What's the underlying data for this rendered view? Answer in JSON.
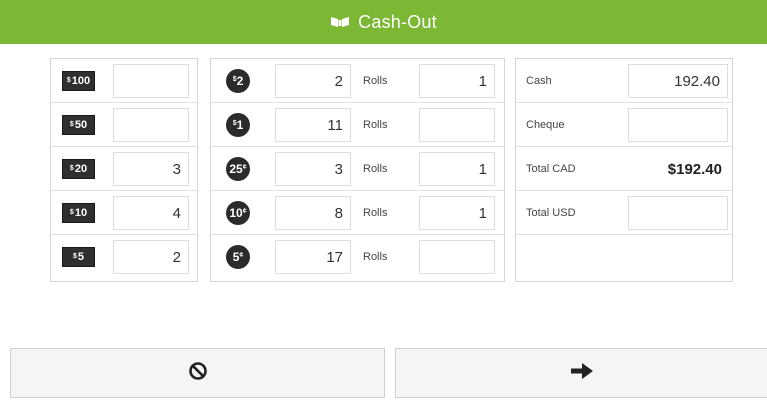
{
  "header": {
    "title": "Cash-Out",
    "logo_icon": "cash-logo-icon"
  },
  "bills": [
    {
      "label": "100",
      "count": ""
    },
    {
      "label": "50",
      "count": ""
    },
    {
      "label": "20",
      "count": "3"
    },
    {
      "label": "10",
      "count": "4"
    },
    {
      "label": "5",
      "count": "2"
    }
  ],
  "coins": [
    {
      "label": "2",
      "unit_prefix": "$",
      "unit_suffix": "",
      "count": "2",
      "rolls_label": "Rolls",
      "rolls": "1"
    },
    {
      "label": "1",
      "unit_prefix": "$",
      "unit_suffix": "",
      "count": "11",
      "rolls_label": "Rolls",
      "rolls": ""
    },
    {
      "label": "25",
      "unit_prefix": "",
      "unit_suffix": "¢",
      "count": "3",
      "rolls_label": "Rolls",
      "rolls": "1"
    },
    {
      "label": "10",
      "unit_prefix": "",
      "unit_suffix": "¢",
      "count": "8",
      "rolls_label": "Rolls",
      "rolls": "1"
    },
    {
      "label": "5",
      "unit_prefix": "",
      "unit_suffix": "¢",
      "count": "17",
      "rolls_label": "Rolls",
      "rolls": ""
    }
  ],
  "totals": {
    "cash_label": "Cash",
    "cash_value": "192.40",
    "cheque_label": "Cheque",
    "cheque_value": "",
    "total_cad_label": "Total CAD",
    "total_cad_value": "$192.40",
    "total_usd_label": "Total USD",
    "total_usd_value": ""
  },
  "actions": {
    "cancel_icon": "cancel-icon",
    "next_icon": "arrow-right-icon"
  },
  "colors": {
    "header": "#7cb833",
    "badge": "#2f2f2f"
  }
}
